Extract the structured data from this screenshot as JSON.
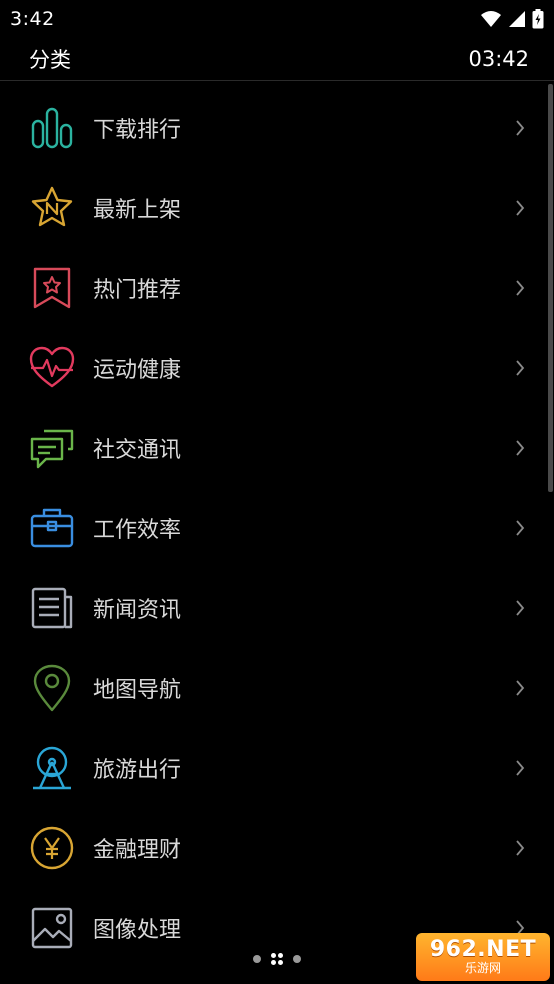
{
  "status_bar": {
    "time": "3:42"
  },
  "header": {
    "title": "分类",
    "clock": "03:42"
  },
  "categories": [
    {
      "label": "下载排行",
      "icon": "bar-chart-icon",
      "color": "#2bb3a0"
    },
    {
      "label": "最新上架",
      "icon": "new-star-icon",
      "color": "#d8a533"
    },
    {
      "label": "热门推荐",
      "icon": "bookmark-star-icon",
      "color": "#d84a5a"
    },
    {
      "label": "运动健康",
      "icon": "heart-pulse-icon",
      "color": "#e23a5e"
    },
    {
      "label": "社交通讯",
      "icon": "chat-bubbles-icon",
      "color": "#6ab54a"
    },
    {
      "label": "工作效率",
      "icon": "briefcase-icon",
      "color": "#3a8ee0"
    },
    {
      "label": "新闻资讯",
      "icon": "newspaper-icon",
      "color": "#a9adb8"
    },
    {
      "label": "地图导航",
      "icon": "map-pin-icon",
      "color": "#5a8a3c"
    },
    {
      "label": "旅游出行",
      "icon": "ferris-wheel-icon",
      "color": "#2aa6d6"
    },
    {
      "label": "金融理财",
      "icon": "yen-coin-icon",
      "color": "#d8a533"
    },
    {
      "label": "图像处理",
      "icon": "image-icon",
      "color": "#a9adb8"
    }
  ],
  "chevron_color": "#8a8a8a",
  "watermark": {
    "top": "962.NET",
    "bottom": "乐游网"
  }
}
